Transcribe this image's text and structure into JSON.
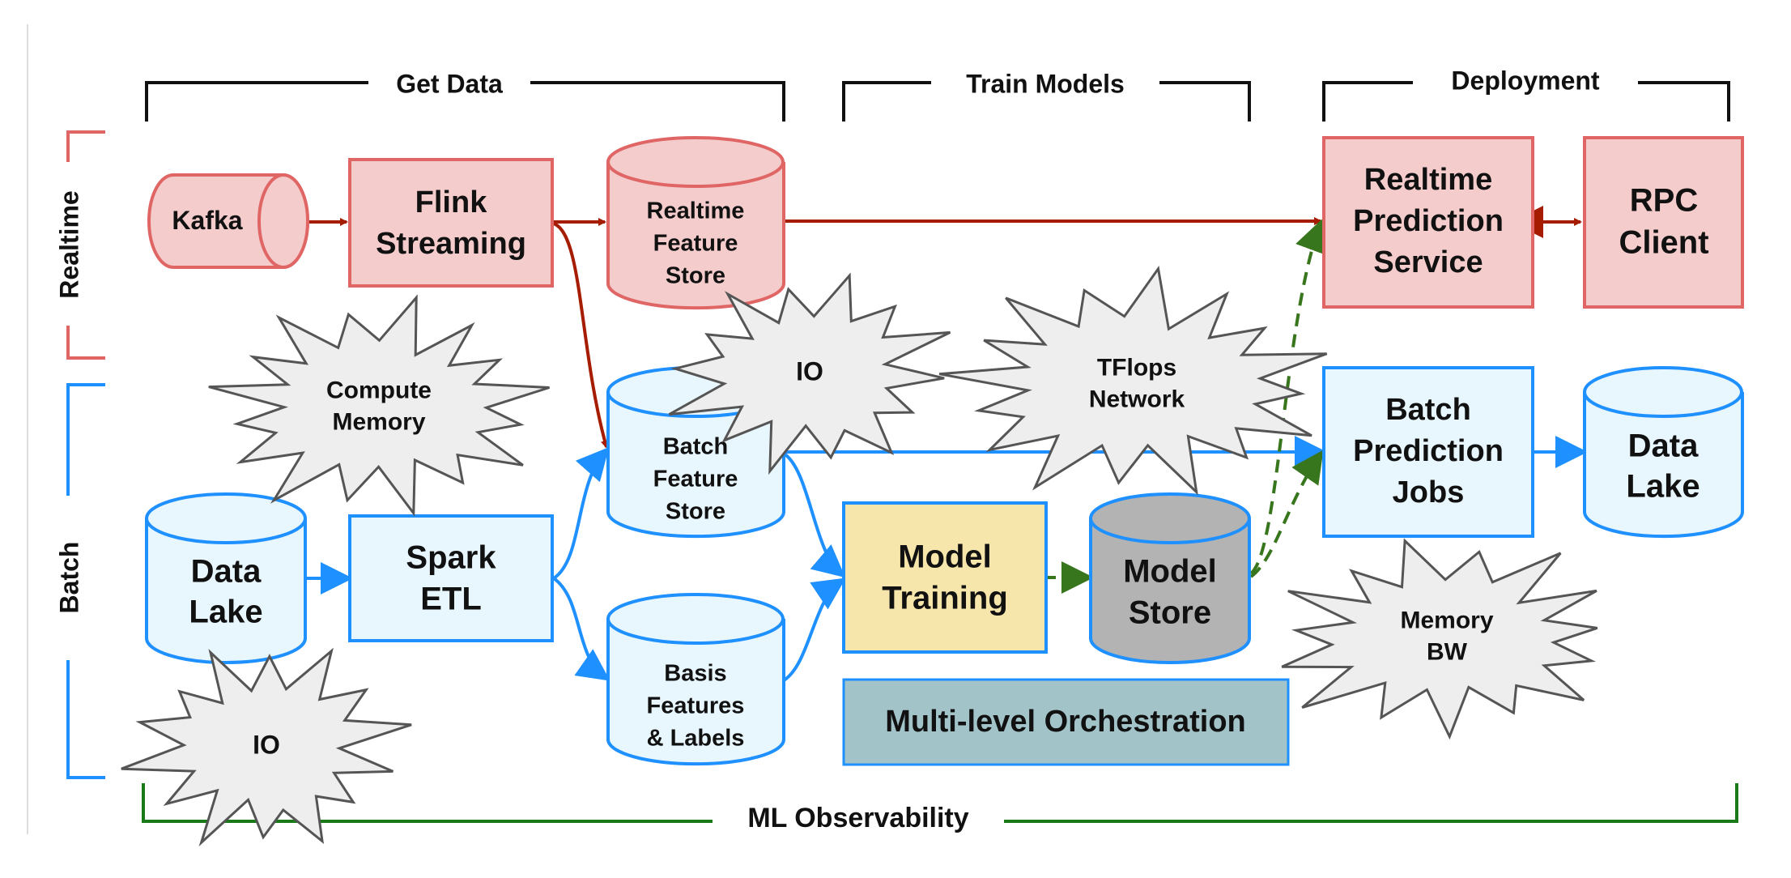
{
  "colors": {
    "realtime_stroke": "#e06666",
    "realtime_fill": "#f4cccc",
    "realtime_arrow": "#a61c00",
    "batch_stroke": "#1e90ff",
    "batch_fill": "#e8f6fd",
    "training_fill": "#f7e6ab",
    "model_store_fill": "#b3b3b3",
    "orchestration_fill": "#a2c4c9",
    "deploy_arrow": "#38761d",
    "observability": "#1a7a1a",
    "burst_fill": "#eeeeee",
    "burst_stroke": "#555555"
  },
  "stages": {
    "get_data": "Get Data",
    "train_models": "Train Models",
    "deployment": "Deployment"
  },
  "lanes": {
    "realtime": "Realtime",
    "batch": "Batch"
  },
  "nodes": {
    "kafka": [
      "Kafka"
    ],
    "flink": [
      "Flink",
      "Streaming"
    ],
    "realtime_feature_store": [
      "Realtime",
      "Feature",
      "Store"
    ],
    "realtime_prediction_service": [
      "Realtime",
      "Prediction",
      "Service"
    ],
    "rpc_client": [
      "RPC",
      "Client"
    ],
    "batch_feature_store": [
      "Batch",
      "Feature",
      "Store"
    ],
    "batch_prediction_jobs": [
      "Batch",
      "Prediction",
      "Jobs"
    ],
    "data_lake_out": [
      "Data",
      "Lake"
    ],
    "data_lake_in": [
      "Data",
      "Lake"
    ],
    "spark_etl": [
      "Spark",
      "ETL"
    ],
    "basis_features": [
      "Basis",
      "Features",
      "& Labels"
    ],
    "model_training": [
      "Model",
      "Training"
    ],
    "model_store": [
      "Model",
      "Store"
    ],
    "orchestration": [
      "Multi-level Orchestration"
    ]
  },
  "bottlenecks": {
    "compute_memory": [
      "Compute",
      "Memory"
    ],
    "io_top": [
      "IO"
    ],
    "tflops_network": [
      "TFlops",
      "Network"
    ],
    "memory_bw": [
      "Memory",
      "BW"
    ],
    "io_bottom": [
      "IO"
    ]
  },
  "footer": {
    "observability": "ML Observability"
  }
}
